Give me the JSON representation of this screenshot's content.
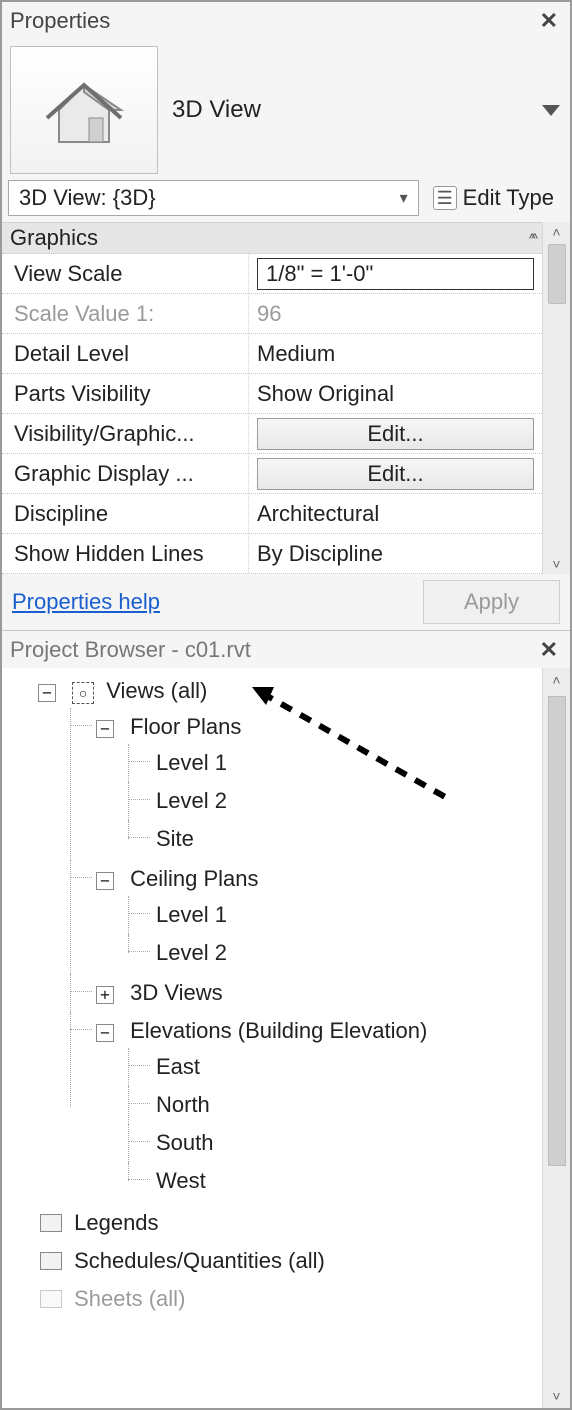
{
  "properties": {
    "title": "Properties",
    "type_label": "3D View",
    "instance_selected": "3D View: {3D}",
    "edit_type_label": "Edit Type",
    "group_header": "Graphics",
    "rows": [
      {
        "label": "View Scale",
        "value": "1/8\" = 1'-0\"",
        "kind": "boxed"
      },
      {
        "label": "Scale Value    1:",
        "value": "96",
        "kind": "disabled"
      },
      {
        "label": "Detail Level",
        "value": "Medium",
        "kind": "text"
      },
      {
        "label": "Parts Visibility",
        "value": "Show Original",
        "kind": "text"
      },
      {
        "label": "Visibility/Graphic...",
        "value": "Edit...",
        "kind": "button"
      },
      {
        "label": "Graphic Display ...",
        "value": "Edit...",
        "kind": "button"
      },
      {
        "label": "Discipline",
        "value": "Architectural",
        "kind": "text"
      },
      {
        "label": "Show Hidden Lines",
        "value": "By Discipline",
        "kind": "text"
      }
    ],
    "help_link": "Properties help",
    "apply_label": "Apply"
  },
  "browser": {
    "title": "Project Browser - c01.rvt",
    "root_label": "Views (all)",
    "floor_plans": {
      "label": "Floor Plans",
      "items": [
        "Level 1",
        "Level 2",
        "Site"
      ]
    },
    "ceiling_plans": {
      "label": "Ceiling Plans",
      "items": [
        "Level 1",
        "Level 2"
      ]
    },
    "views3d_label": "3D Views",
    "elevations": {
      "label": "Elevations (Building Elevation)",
      "items": [
        "East",
        "North",
        "South",
        "West"
      ]
    },
    "legends_label": "Legends",
    "schedules_label": "Schedules/Quantities (all)",
    "sheets_label": "Sheets (all)"
  }
}
